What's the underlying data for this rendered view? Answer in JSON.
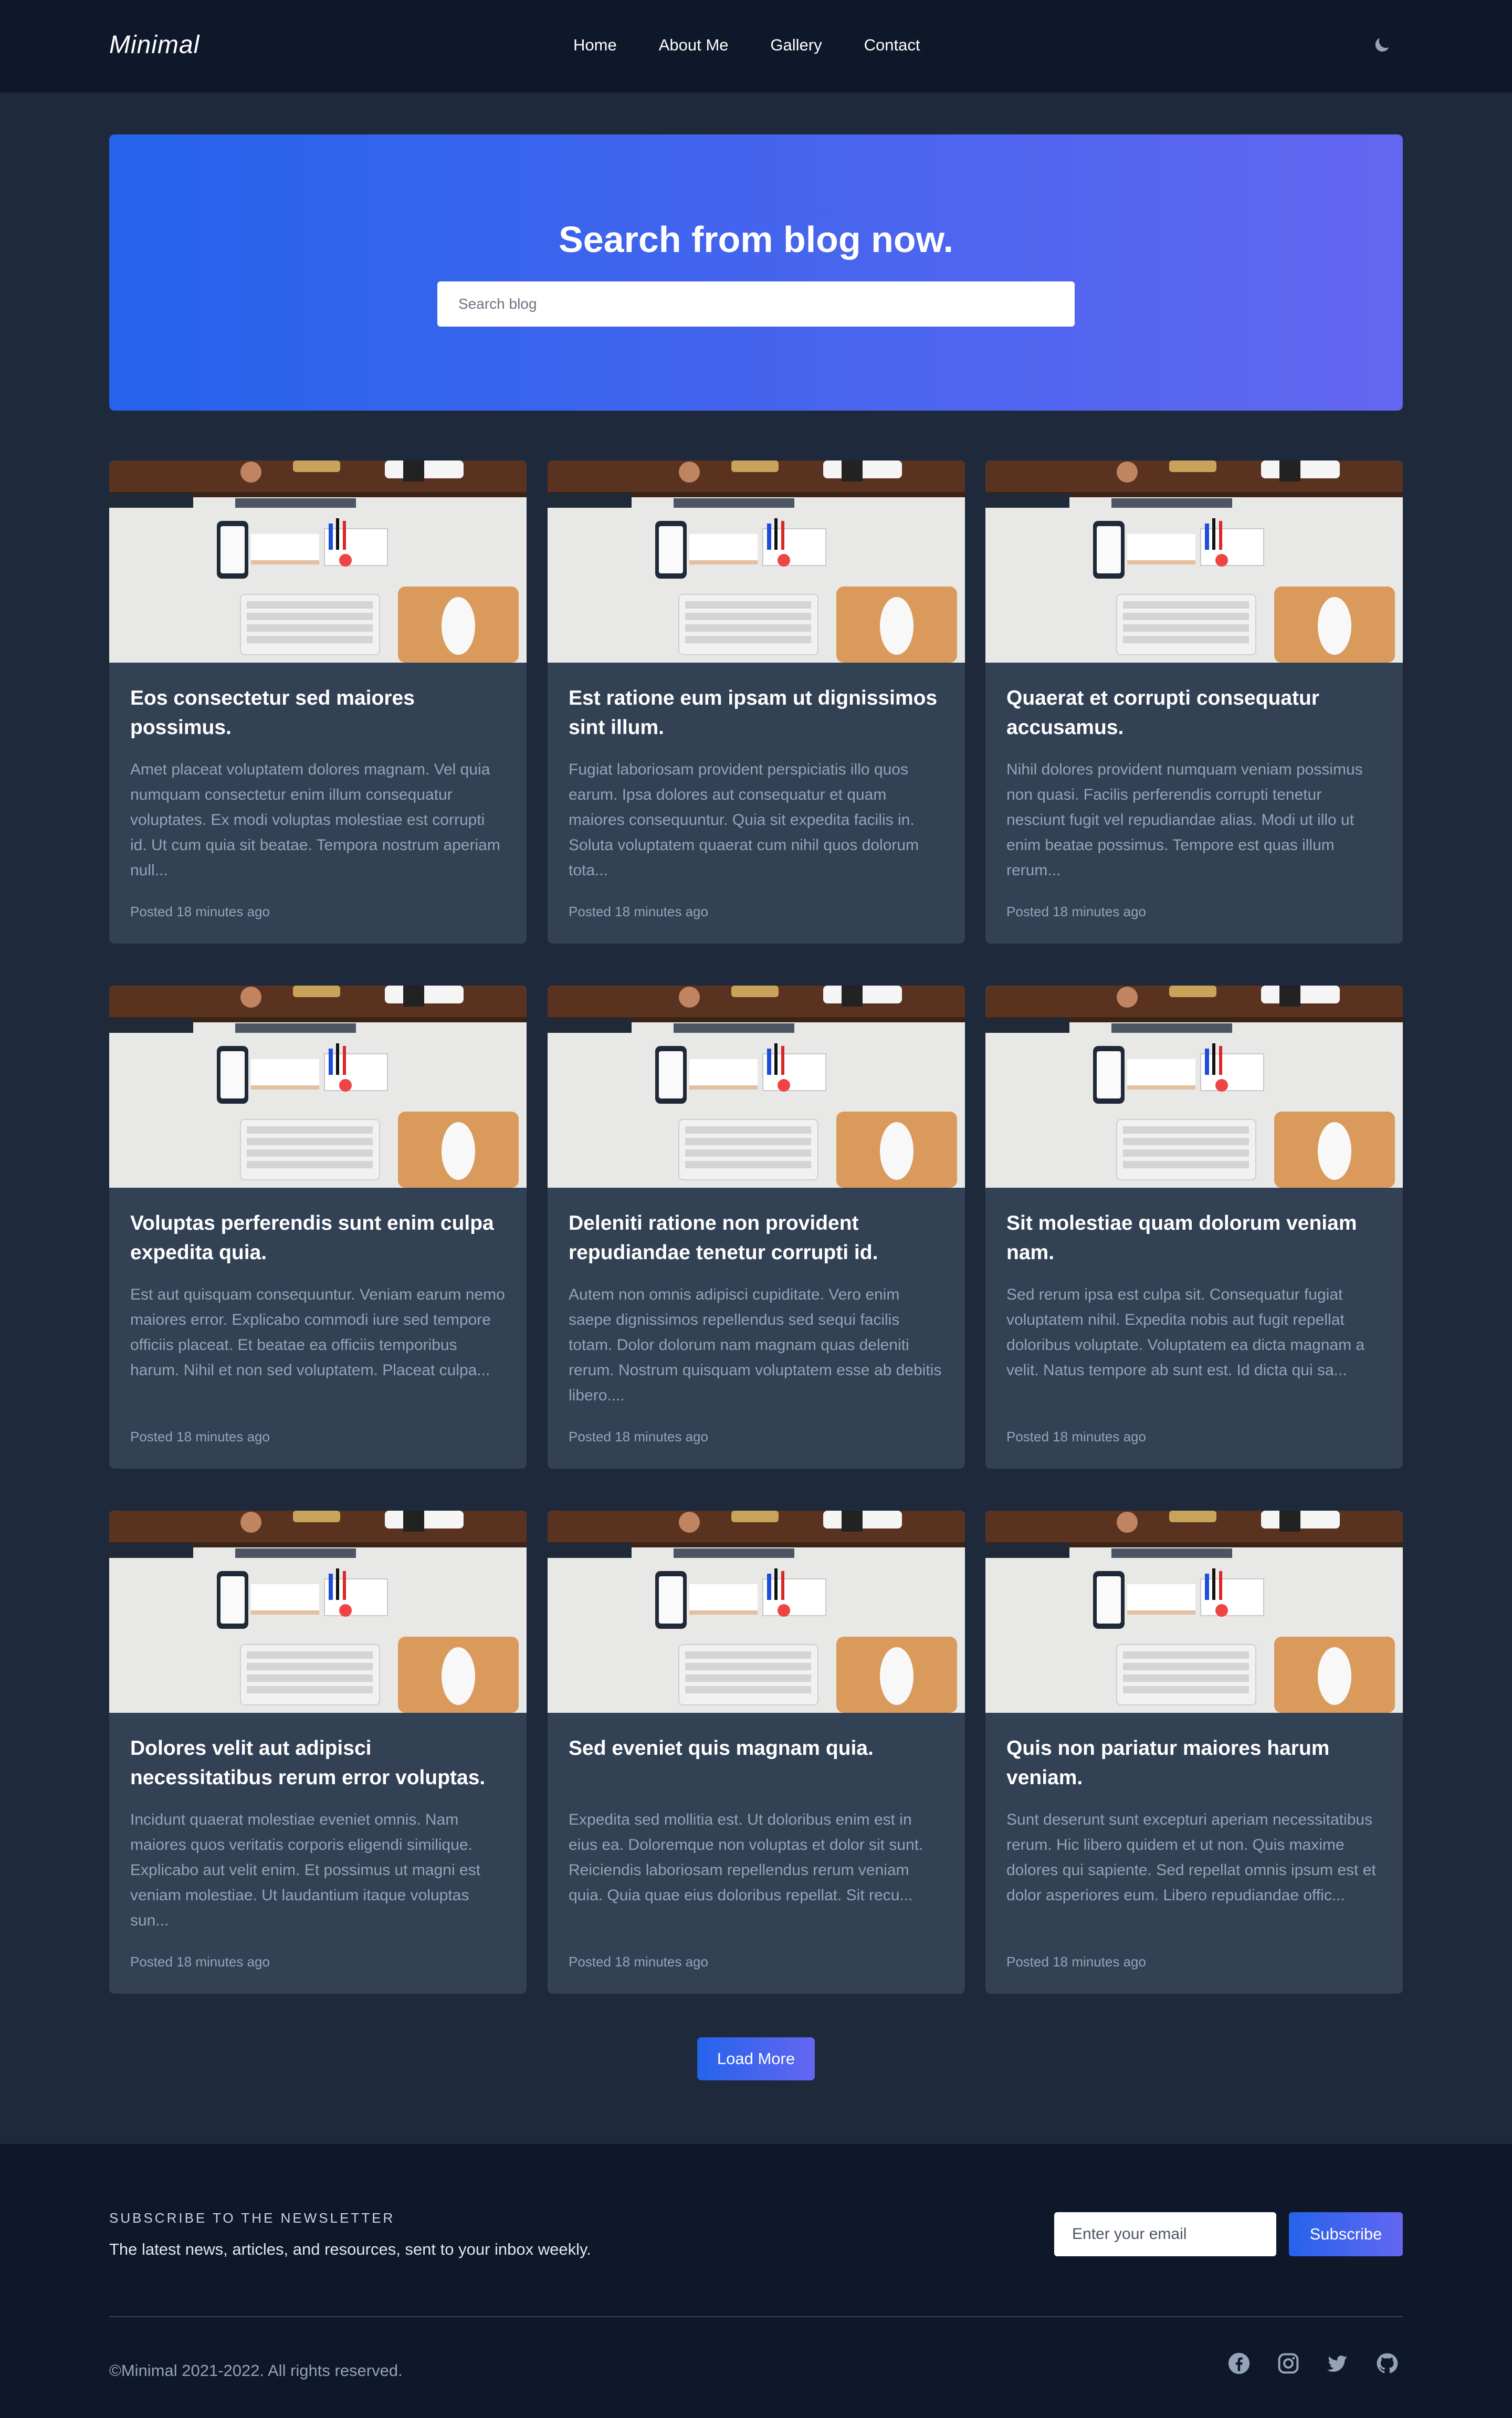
{
  "nav": {
    "logo": "Minimal",
    "links": [
      "Home",
      "About Me",
      "Gallery",
      "Contact"
    ],
    "theme_icon": "moon-icon"
  },
  "hero": {
    "title": "Search from blog now.",
    "search_placeholder": "Search blog"
  },
  "posts": [
    {
      "title": "Eos consectetur sed maiores possimus.",
      "excerpt": "Amet placeat voluptatem dolores magnam. Vel quia numquam consectetur enim illum consequatur voluptates. Ex modi voluptas molestiae est corrupti id. Ut cum quia sit beatae. Tempora nostrum aperiam null...",
      "meta": "Posted 18 minutes ago"
    },
    {
      "title": "Est ratione eum ipsam ut dignissimos sint illum.",
      "excerpt": "Fugiat laboriosam provident perspiciatis illo quos earum. Ipsa dolores aut consequatur et quam maiores consequuntur. Quia sit expedita facilis in. Soluta voluptatem quaerat cum nihil quos dolorum tota...",
      "meta": "Posted 18 minutes ago"
    },
    {
      "title": "Quaerat et corrupti consequatur accusamus.",
      "excerpt": "Nihil dolores provident numquam veniam possimus non quasi. Facilis perferendis corrupti tenetur nesciunt fugit vel repudiandae alias. Modi ut illo ut enim beatae possimus. Tempore est quas illum rerum...",
      "meta": "Posted 18 minutes ago"
    },
    {
      "title": "Voluptas perferendis sunt enim culpa expedita quia.",
      "excerpt": "Est aut quisquam consequuntur. Veniam earum nemo maiores error. Explicabo commodi iure sed tempore officiis placeat. Et beatae ea officiis temporibus harum. Nihil et non sed voluptatem. Placeat culpa...",
      "meta": "Posted 18 minutes ago"
    },
    {
      "title": "Deleniti ratione non provident repudiandae tenetur corrupti id.",
      "excerpt": "Autem non omnis adipisci cupiditate. Vero enim saepe dignissimos repellendus sed sequi facilis totam. Dolor dolorum nam magnam quas deleniti rerum. Nostrum quisquam voluptatem esse ab debitis libero....",
      "meta": "Posted 18 minutes ago"
    },
    {
      "title": "Sit molestiae quam dolorum veniam nam.",
      "excerpt": "Sed rerum ipsa est culpa sit. Consequatur fugiat voluptatem nihil. Expedita nobis aut fugit repellat doloribus voluptate. Voluptatem ea dicta magnam a velit. Natus tempore ab sunt est. Id dicta qui sa...",
      "meta": "Posted 18 minutes ago"
    },
    {
      "title": "Dolores velit aut adipisci necessitatibus rerum error voluptas.",
      "excerpt": "Incidunt quaerat molestiae eveniet omnis. Nam maiores quos veritatis corporis eligendi similique. Explicabo aut velit enim. Et possimus ut magni est veniam molestiae. Ut laudantium itaque voluptas sun...",
      "meta": "Posted 18 minutes ago"
    },
    {
      "title": "Sed eveniet quis magnam quia.",
      "excerpt": "Expedita sed mollitia est. Ut doloribus enim est in eius ea. Doloremque non voluptas et dolor sit sunt. Reiciendis laboriosam repellendus rerum veniam quia. Quia quae eius doloribus repellat. Sit recu...",
      "meta": "Posted 18 minutes ago"
    },
    {
      "title": "Quis non pariatur maiores harum veniam.",
      "excerpt": "Sunt deserunt sunt excepturi aperiam necessitatibus rerum. Hic libero quidem et ut non. Quis maxime dolores qui sapiente. Sed repellat omnis ipsum est et dolor asperiores eum. Libero repudiandae offic...",
      "meta": "Posted 18 minutes ago"
    }
  ],
  "load_more": "Load More",
  "footer": {
    "newsletter_heading": "SUBSCRIBE TO THE NEWSLETTER",
    "newsletter_sub": "The latest news, articles, and resources, sent to your inbox weekly.",
    "email_placeholder": "Enter your email",
    "subscribe_label": "Subscribe",
    "copyright": "©Minimal 2021-2022. All rights reserved.",
    "social_icons": [
      "facebook-icon",
      "instagram-icon",
      "twitter-icon",
      "github-icon"
    ]
  },
  "colors": {
    "page_bg": "#1e293b",
    "nav_bg": "#0f172a",
    "card_bg": "#334155",
    "accent_start": "#2563eb",
    "accent_end": "#6366f1"
  }
}
